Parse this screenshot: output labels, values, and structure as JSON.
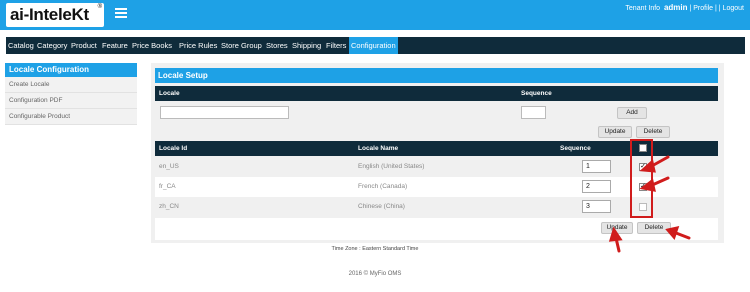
{
  "header": {
    "logo_text": "ai-InteleKt",
    "logo_mark": "®",
    "tenant_info": "Tenant Info",
    "user": "admin",
    "profile": "Profile",
    "logout": "Logout",
    "sep1": "|",
    "sep2": "| |"
  },
  "nav": {
    "items": [
      "Catalog",
      "Category",
      "Product",
      "Feature",
      "Price Books",
      "Price Rules",
      "Store Group",
      "Stores",
      "Shipping",
      "Filters",
      "Configuration"
    ],
    "active": "Configuration"
  },
  "sidebar": {
    "title": "Locale  Configuration",
    "items": [
      "Create Locale",
      "Configuration PDF",
      "Configurable Product"
    ]
  },
  "locale_setup": {
    "title": "Locale  Setup",
    "col_locale": "Locale",
    "col_sequence": "Sequence",
    "locale_value": "",
    "sequence_value": "",
    "add_button": "Add",
    "update_button": "Update",
    "delete_button": "Delete"
  },
  "locale_table": {
    "col_id": "Locale Id",
    "col_name": "Locale Name",
    "col_sequence": "Sequence",
    "rows": [
      {
        "id": "en_US",
        "name": "English (United States)",
        "sequence": "1",
        "checked": true
      },
      {
        "id": "fr_CA",
        "name": "French (Canada)",
        "sequence": "2",
        "checked": true
      },
      {
        "id": "zh_CN",
        "name": "Chinese (China)",
        "sequence": "3",
        "checked": false
      }
    ],
    "update_button": "Update",
    "delete_button": "Delete"
  },
  "footer": {
    "timezone": "Time Zone : Eastern Standard Time",
    "copyright": "2016 © MyFio OMS"
  },
  "colors": {
    "accent": "#1ea1e6",
    "dark": "#0f2b3b",
    "annotation": "#d01c1c"
  }
}
